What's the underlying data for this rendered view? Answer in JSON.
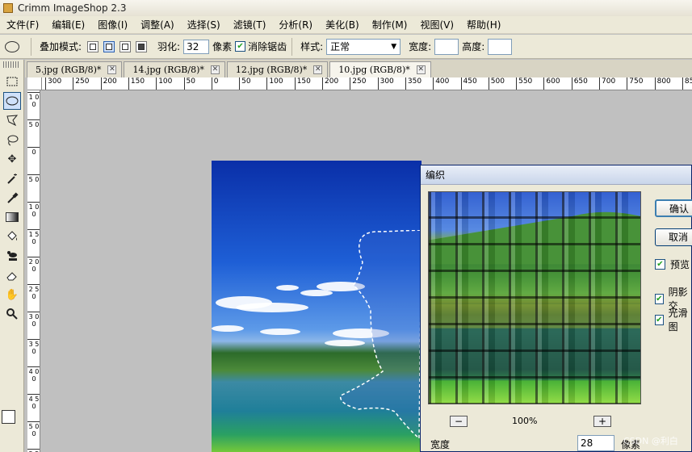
{
  "app": {
    "title": "Crimm ImageShop 2.3"
  },
  "menu": [
    "文件(F)",
    "编辑(E)",
    "图像(I)",
    "调整(A)",
    "选择(S)",
    "滤镜(T)",
    "分析(R)",
    "美化(B)",
    "制作(M)",
    "视图(V)",
    "帮助(H)"
  ],
  "options": {
    "blend_mode_label": "叠加模式:",
    "feather_label": "羽化:",
    "feather_value": "32",
    "feather_unit": "像素",
    "antialias_label": "消除锯齿",
    "antialias_checked": true,
    "style_label": "样式:",
    "style_value": "正常",
    "width_label": "宽度:",
    "height_label": "高度:"
  },
  "tools": [
    "rect-marquee-icon",
    "ellipse-marquee-icon",
    "polygon-lasso-icon",
    "lasso-icon",
    "move-icon",
    "magic-wand-icon",
    "eyedropper-icon",
    "gradient-icon",
    "paint-bucket-icon",
    "clone-stamp-icon",
    "eraser-icon",
    "hand-icon",
    "zoom-icon"
  ],
  "tabs": [
    {
      "label": "5.jpg (RGB/8)*",
      "active": false
    },
    {
      "label": "14.jpg (RGB/8)*",
      "active": false
    },
    {
      "label": "12.jpg (RGB/8)*",
      "active": false
    },
    {
      "label": "10.jpg (RGB/8)*",
      "active": true
    }
  ],
  "hruler": [
    "300",
    "250",
    "200",
    "150",
    "100",
    "50",
    "0",
    "50",
    "100",
    "150",
    "200",
    "250",
    "300",
    "350",
    "400",
    "450",
    "500",
    "550",
    "600",
    "650",
    "700",
    "750",
    "800",
    "850"
  ],
  "vruler": [
    "1 0 0",
    "5 0",
    "0",
    "5 0",
    "1 0 0",
    "1 5 0",
    "2 0 0",
    "2 5 0",
    "3 0 0",
    "3 5 0",
    "4 0 0",
    "4 5 0",
    "5 0 0",
    "5 5 0"
  ],
  "dialog": {
    "title": "编织",
    "ok_label": "确认",
    "cancel_label": "取消",
    "preview_label": "预览",
    "preview_checked": true,
    "shadow_label": "阴影交",
    "shadow_checked": true,
    "smooth_label": "光滑图",
    "smooth_checked": true,
    "zoom_out_label": "−",
    "zoom_level": "100%",
    "zoom_in_label": "+",
    "width_label": "宽度",
    "width_value": "28",
    "width_unit": "像素"
  },
  "watermark": "CSDN @利白",
  "colors": {
    "accent": "#0a246a",
    "toolbar_bg": "#ece9d8",
    "workspace_bg": "#c0c0c0"
  }
}
